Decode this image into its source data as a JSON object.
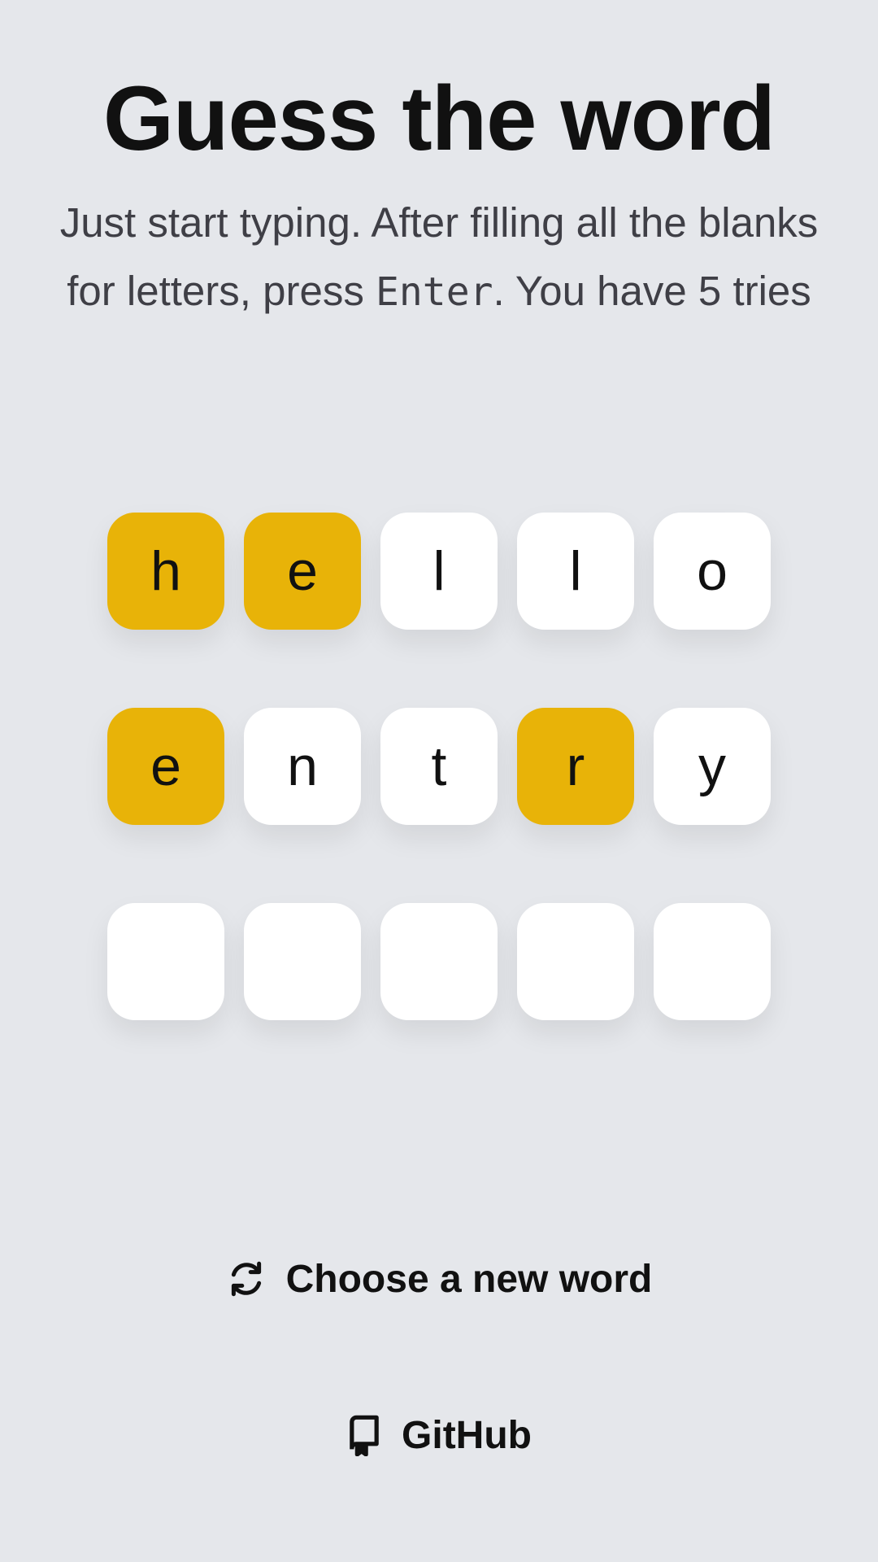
{
  "header": {
    "title": "Guess the word",
    "instructions_part1": "Just start typing. After filling all the blanks for letters, press ",
    "instructions_key": "Enter",
    "instructions_part2": ". You have 5 tries"
  },
  "board": {
    "rows": [
      [
        {
          "letter": "h",
          "state": "present"
        },
        {
          "letter": "e",
          "state": "present"
        },
        {
          "letter": "l",
          "state": "absent"
        },
        {
          "letter": "l",
          "state": "absent"
        },
        {
          "letter": "o",
          "state": "absent"
        }
      ],
      [
        {
          "letter": "e",
          "state": "present"
        },
        {
          "letter": "n",
          "state": "absent"
        },
        {
          "letter": "t",
          "state": "absent"
        },
        {
          "letter": "r",
          "state": "present"
        },
        {
          "letter": "y",
          "state": "absent"
        }
      ],
      [
        {
          "letter": "",
          "state": "empty"
        },
        {
          "letter": "",
          "state": "empty"
        },
        {
          "letter": "",
          "state": "empty"
        },
        {
          "letter": "",
          "state": "empty"
        },
        {
          "letter": "",
          "state": "empty"
        }
      ]
    ]
  },
  "actions": {
    "new_word_label": "Choose a new word",
    "new_word_icon": "refresh-icon",
    "github_label": "GitHub",
    "github_icon": "repo-icon"
  },
  "colors": {
    "background": "#e5e7eb",
    "present": "#e8b308",
    "tile": "#ffffff"
  }
}
